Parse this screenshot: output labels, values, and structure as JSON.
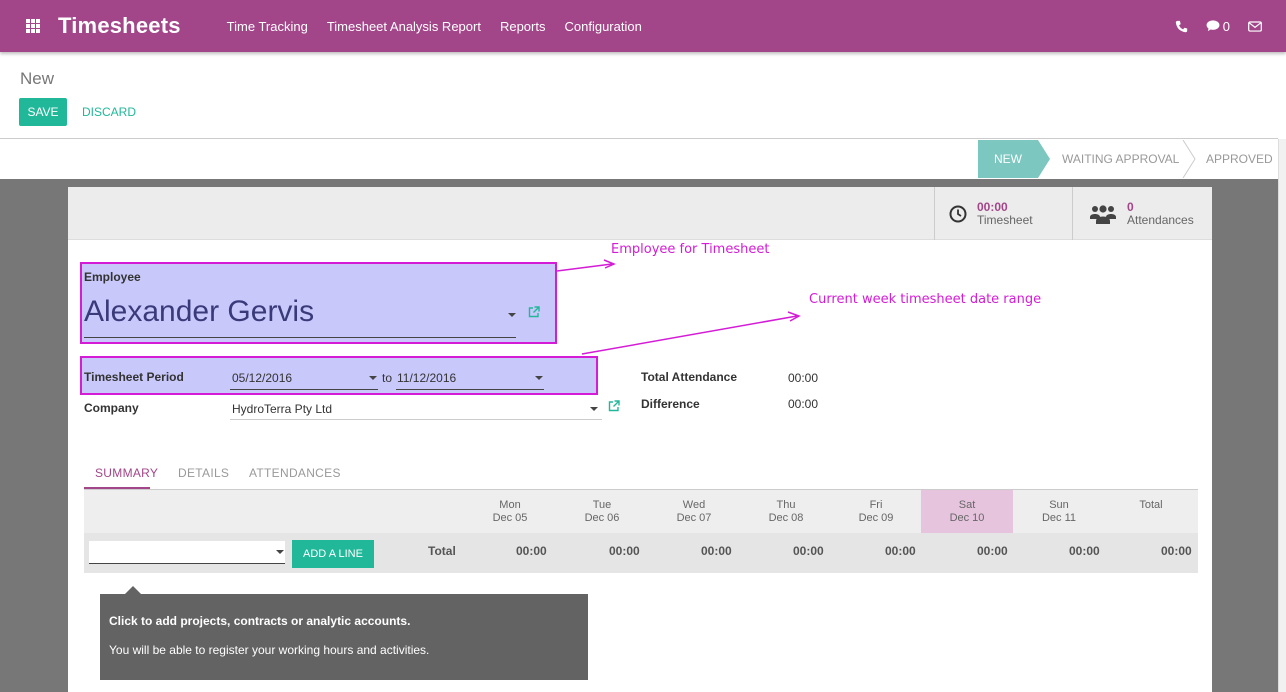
{
  "topbar": {
    "brand": "Timesheets",
    "menu": [
      "Time Tracking",
      "Timesheet Analysis Report",
      "Reports",
      "Configuration"
    ],
    "chat_count": "0"
  },
  "control": {
    "title": "New",
    "save_label": "SAVE",
    "discard_label": "DISCARD"
  },
  "stages": [
    "NEW",
    "WAITING APPROVAL",
    "APPROVED"
  ],
  "buttonbox": {
    "timesheet_value": "00:00",
    "timesheet_label": "Timesheet",
    "attendances_value": "0",
    "attendances_label": "Attendances"
  },
  "form": {
    "employee_label": "Employee",
    "employee_value": "Alexander Gervis",
    "period_label": "Timesheet Period",
    "date_from": "05/12/2016",
    "to_word": "to",
    "date_to": "11/12/2016",
    "company_label": "Company",
    "company_value": "HydroTerra Pty Ltd",
    "total_attendance_label": "Total Attendance",
    "total_attendance_value": "00:00",
    "difference_label": "Difference",
    "difference_value": "00:00"
  },
  "annotations": {
    "employee": "Employee for Timesheet",
    "period": "Current week timesheet date range"
  },
  "tabs": [
    "SUMMARY",
    "DETAILS",
    "ATTENDANCES"
  ],
  "summary_table": {
    "columns": [
      {
        "day": "Mon",
        "date": "Dec 05"
      },
      {
        "day": "Tue",
        "date": "Dec 06"
      },
      {
        "day": "Wed",
        "date": "Dec 07"
      },
      {
        "day": "Thu",
        "date": "Dec 08"
      },
      {
        "day": "Fri",
        "date": "Dec 09"
      },
      {
        "day": "Sat",
        "date": "Dec 10"
      },
      {
        "day": "Sun",
        "date": "Dec 11"
      },
      {
        "day": "Total",
        "date": ""
      }
    ],
    "add_line_label": "ADD A LINE",
    "total_label": "Total",
    "totals": [
      "00:00",
      "00:00",
      "00:00",
      "00:00",
      "00:00",
      "00:00",
      "00:00",
      "00:00"
    ]
  },
  "help": {
    "title": "Click to add projects, contracts or analytic accounts.",
    "text": "You will be able to register your working hours and activities."
  },
  "colors": {
    "brand": "#a24689",
    "accent": "#21b799",
    "highlight_border": "#d41cd6",
    "highlight_fill": "#c8c8fb"
  }
}
